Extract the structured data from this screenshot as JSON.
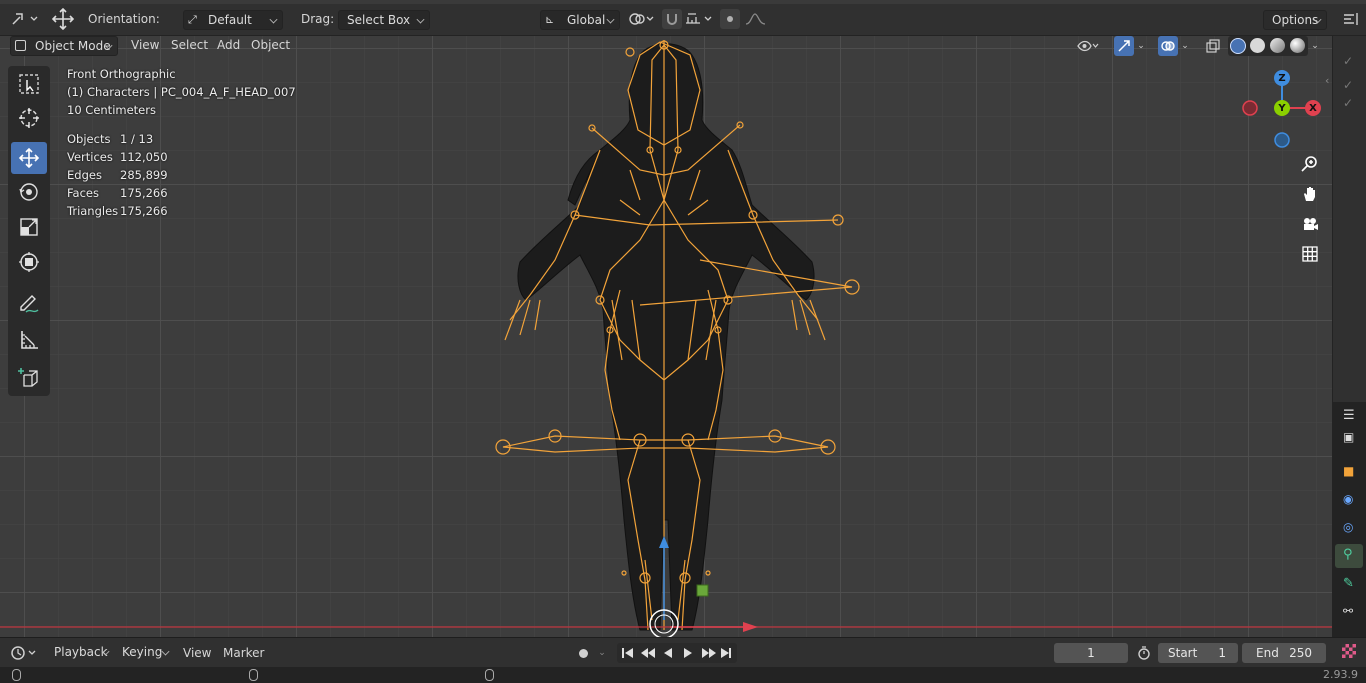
{
  "tool_settings": {
    "orientation_label": "Orientation:",
    "orientation_value": "Default",
    "drag_label": "Drag:",
    "drag_value": "Select Box",
    "transform_orientation": "Global",
    "options_label": "Options"
  },
  "viewport_header": {
    "mode": "Object Mode",
    "menu": [
      "View",
      "Select",
      "Add",
      "Object"
    ]
  },
  "overlay": {
    "view_name": "Front Orthographic",
    "collection": "(1) Characters | PC_004_A_F_HEAD_007",
    "scale": "10 Centimeters",
    "stats": [
      {
        "label": "Objects",
        "value": "1 / 13"
      },
      {
        "label": "Vertices",
        "value": "112,050"
      },
      {
        "label": "Edges",
        "value": "285,899"
      },
      {
        "label": "Faces",
        "value": "175,266"
      },
      {
        "label": "Triangles",
        "value": "175,266"
      }
    ]
  },
  "gizmo": {
    "z": "Z",
    "y": "Y",
    "x": "X"
  },
  "timeline": {
    "menu": [
      "Playback",
      "Keying",
      "View",
      "Marker"
    ],
    "current_frame": "1",
    "start_label": "Start",
    "start_value": "1",
    "end_label": "End",
    "end_value": "250"
  },
  "status": {
    "version": "2.93.9"
  },
  "colors": {
    "accent": "#4772b3",
    "bone": "#f2a33a",
    "x_axis": "#e0414f",
    "y_axis": "#8bd000",
    "z_axis": "#3f8de0"
  }
}
